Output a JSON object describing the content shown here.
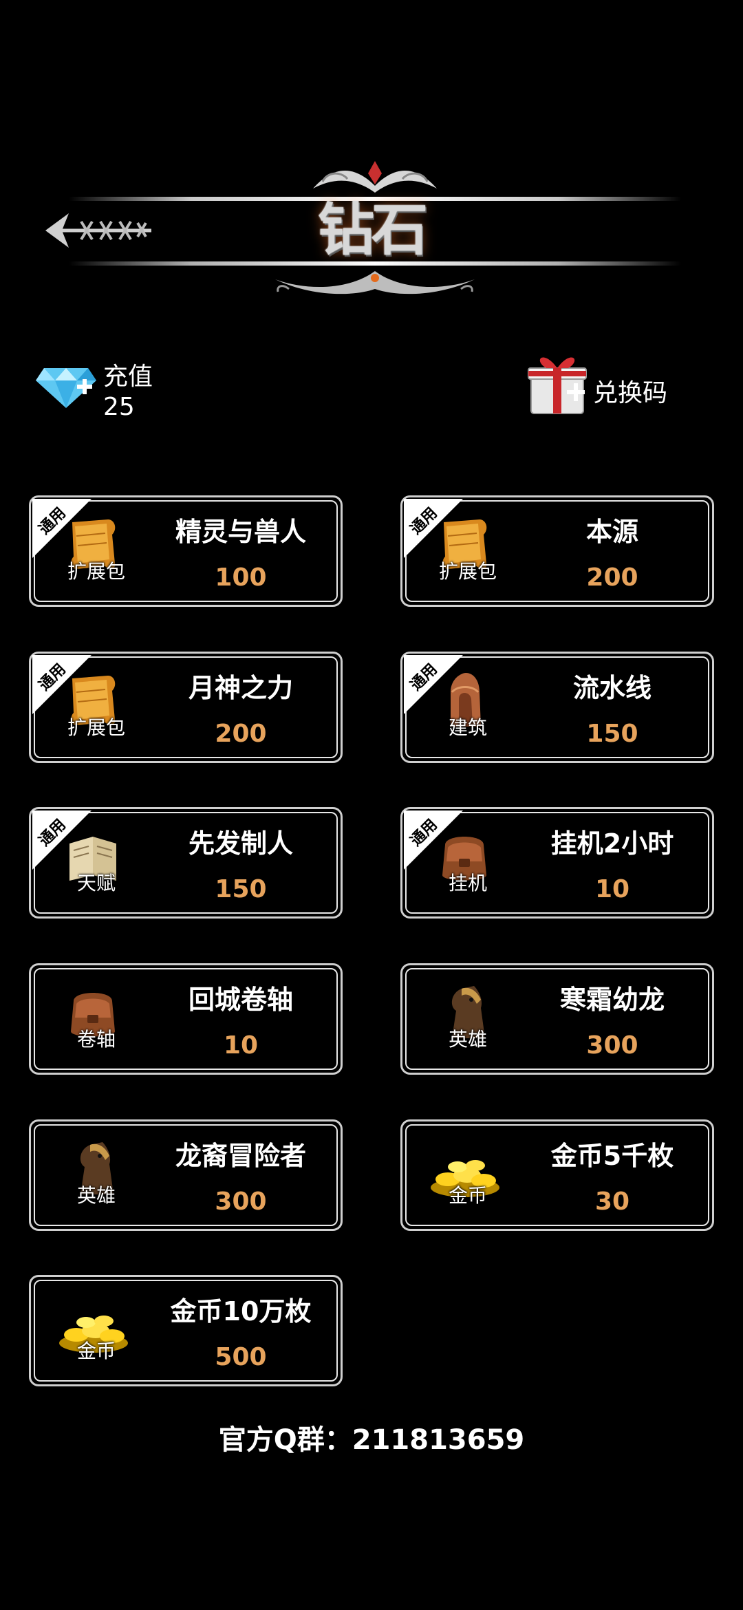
{
  "header": {
    "title": "钻石",
    "back_icon": "arrow-back-icon"
  },
  "currency": {
    "recharge_label": "充值",
    "diamond_count": "25",
    "diamond_icon": "diamond-icon",
    "redeem_label": "兑换码",
    "gift_icon": "gift-box-icon"
  },
  "badge_text": "通用",
  "colors": {
    "price": "#e7a35c",
    "card_border": "#cfcfcf",
    "background": "#000000"
  },
  "items": [
    {
      "name": "精灵与兽人",
      "price": "100",
      "type": "扩展包",
      "icon": "scroll-icon",
      "badge": true
    },
    {
      "name": "本源",
      "price": "200",
      "type": "扩展包",
      "icon": "scroll-icon",
      "badge": true
    },
    {
      "name": "月神之力",
      "price": "200",
      "type": "扩展包",
      "icon": "scroll-icon",
      "badge": true
    },
    {
      "name": "流水线",
      "price": "150",
      "type": "建筑",
      "icon": "building-icon",
      "badge": true
    },
    {
      "name": "先发制人",
      "price": "150",
      "type": "天赋",
      "icon": "book-icon",
      "badge": true
    },
    {
      "name": "挂机2小时",
      "price": "10",
      "type": "挂机",
      "icon": "bag-icon",
      "badge": true
    },
    {
      "name": "回城卷轴",
      "price": "10",
      "type": "卷轴",
      "icon": "bag-icon",
      "badge": false
    },
    {
      "name": "寒霜幼龙",
      "price": "300",
      "type": "英雄",
      "icon": "horse-hero-icon",
      "badge": false
    },
    {
      "name": "龙裔冒险者",
      "price": "300",
      "type": "英雄",
      "icon": "horse-hero-icon",
      "badge": false
    },
    {
      "name": "金币5千枚",
      "price": "30",
      "type": "金币",
      "icon": "gold-coins-icon",
      "badge": false
    },
    {
      "name": "金币10万枚",
      "price": "500",
      "type": "金币",
      "icon": "gold-coins-icon",
      "badge": false
    }
  ],
  "footer": {
    "qq_group": "官方Q群：211813659"
  }
}
